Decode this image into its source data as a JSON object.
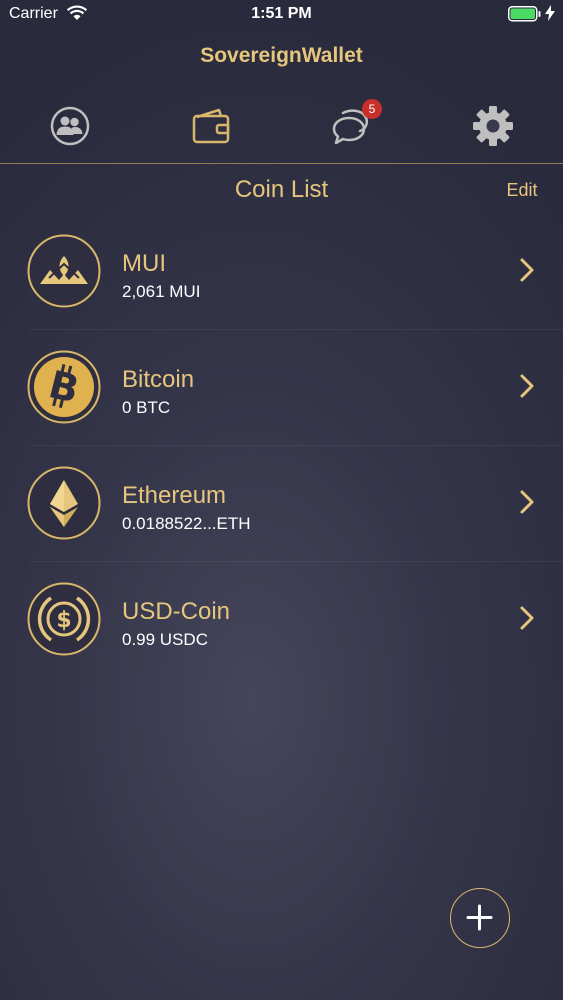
{
  "status_bar": {
    "carrier": "Carrier",
    "time": "1:51 PM"
  },
  "header": {
    "title": "SovereignWallet",
    "nav": [
      {
        "name": "contacts",
        "icon": "contacts-icon"
      },
      {
        "name": "wallet",
        "icon": "wallet-icon"
      },
      {
        "name": "messages",
        "icon": "chat-icon",
        "badge": "5"
      },
      {
        "name": "settings",
        "icon": "gear-icon"
      }
    ]
  },
  "coin_list": {
    "title": "Coin List",
    "edit_label": "Edit",
    "coins": [
      {
        "name": "MUI",
        "balance": "2,061 MUI",
        "icon": "mui-logo-icon"
      },
      {
        "name": "Bitcoin",
        "balance": "0 BTC",
        "icon": "bitcoin-icon"
      },
      {
        "name": "Ethereum",
        "balance": "0.0188522...ETH",
        "icon": "ethereum-icon"
      },
      {
        "name": "USD-Coin",
        "balance": "0.99 USDC",
        "icon": "usdc-icon"
      }
    ]
  },
  "colors": {
    "accent_gold": "#e6c67d",
    "background": "#35354a",
    "badge_red": "#c7302b"
  },
  "add_button": {
    "icon": "plus-icon"
  }
}
